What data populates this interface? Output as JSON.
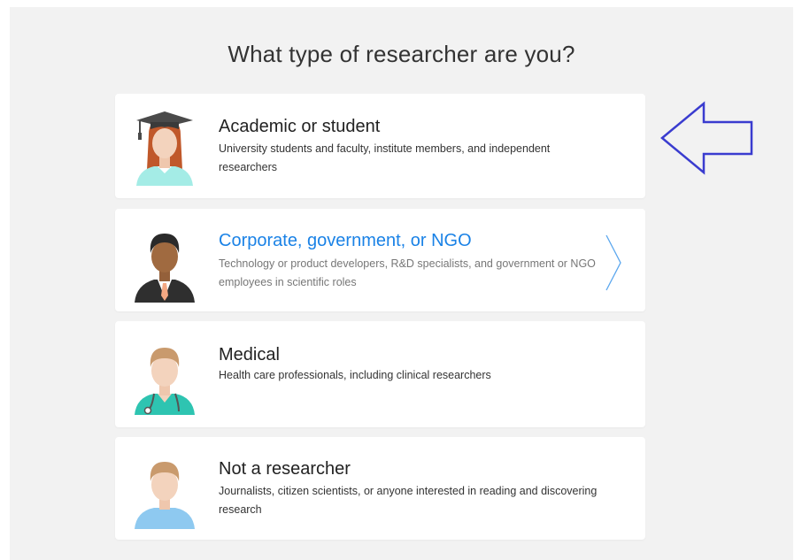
{
  "page": {
    "title": "What type of researcher are you?"
  },
  "options": [
    {
      "title": "Academic or student",
      "description": "University students and faculty, institute members, and independent researchers",
      "avatar": "graduate-student-avatar-icon"
    },
    {
      "title": "Corporate, government, or NGO",
      "description": "Technology or product developers, R&D specialists, and government or NGO employees in scientific roles",
      "avatar": "business-person-avatar-icon",
      "state": "hover"
    },
    {
      "title": "Medical",
      "description": "Health care professionals, including clinical researchers",
      "avatar": "doctor-avatar-icon"
    },
    {
      "title": "Not a researcher",
      "description": "Journalists, citizen scientists, or anyone interested in reading and discovering research",
      "avatar": "person-avatar-icon"
    }
  ],
  "colors": {
    "accent": "#1a82e6",
    "panel_bg": "#f2f2f2",
    "card_bg": "#ffffff",
    "annotation_arrow": "#3a3ccf"
  }
}
